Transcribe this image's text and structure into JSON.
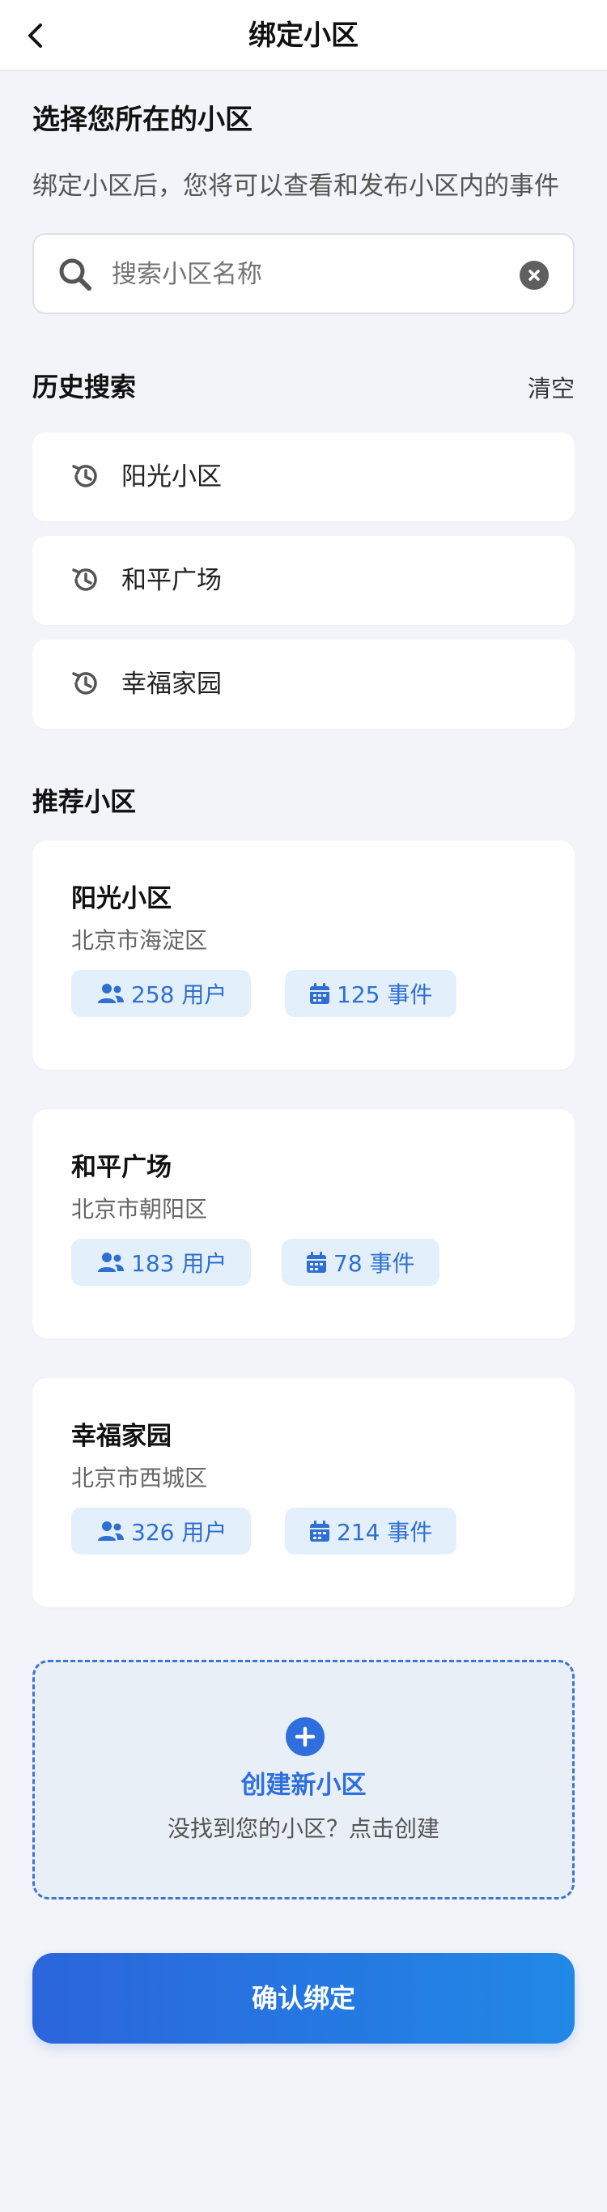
{
  "header": {
    "title": "绑定小区"
  },
  "intro": {
    "heading": "选择您所在的小区",
    "description": "绑定小区后，您将可以查看和发布小区内的事件"
  },
  "search": {
    "placeholder": "搜索小区名称"
  },
  "history": {
    "heading": "历史搜索",
    "clear_label": "清空",
    "items": [
      {
        "label": "阳光小区"
      },
      {
        "label": "和平广场"
      },
      {
        "label": "幸福家园"
      }
    ]
  },
  "recommended": {
    "heading": "推荐小区",
    "cards": [
      {
        "name": "阳光小区",
        "address": "北京市海淀区",
        "users": "258 用户",
        "events": "125 事件"
      },
      {
        "name": "和平广场",
        "address": "北京市朝阳区",
        "users": "183 用户",
        "events": "78 事件"
      },
      {
        "name": "幸福家园",
        "address": "北京市西城区",
        "users": "326 用户",
        "events": "214 事件"
      }
    ]
  },
  "create": {
    "title": "创建新小区",
    "subtitle": "没找到您的小区？点击创建"
  },
  "confirm": {
    "label": "确认绑定"
  },
  "icons": {
    "back": "chevron-left-icon",
    "search": "search-icon",
    "clear": "close-circle-icon",
    "history": "history-icon",
    "users": "users-icon",
    "calendar": "calendar-icon",
    "plus": "plus-circle-icon"
  },
  "colors": {
    "accent": "#2f6fdd",
    "badge_bg": "#e3f0fb",
    "background": "#f3f4f9"
  }
}
